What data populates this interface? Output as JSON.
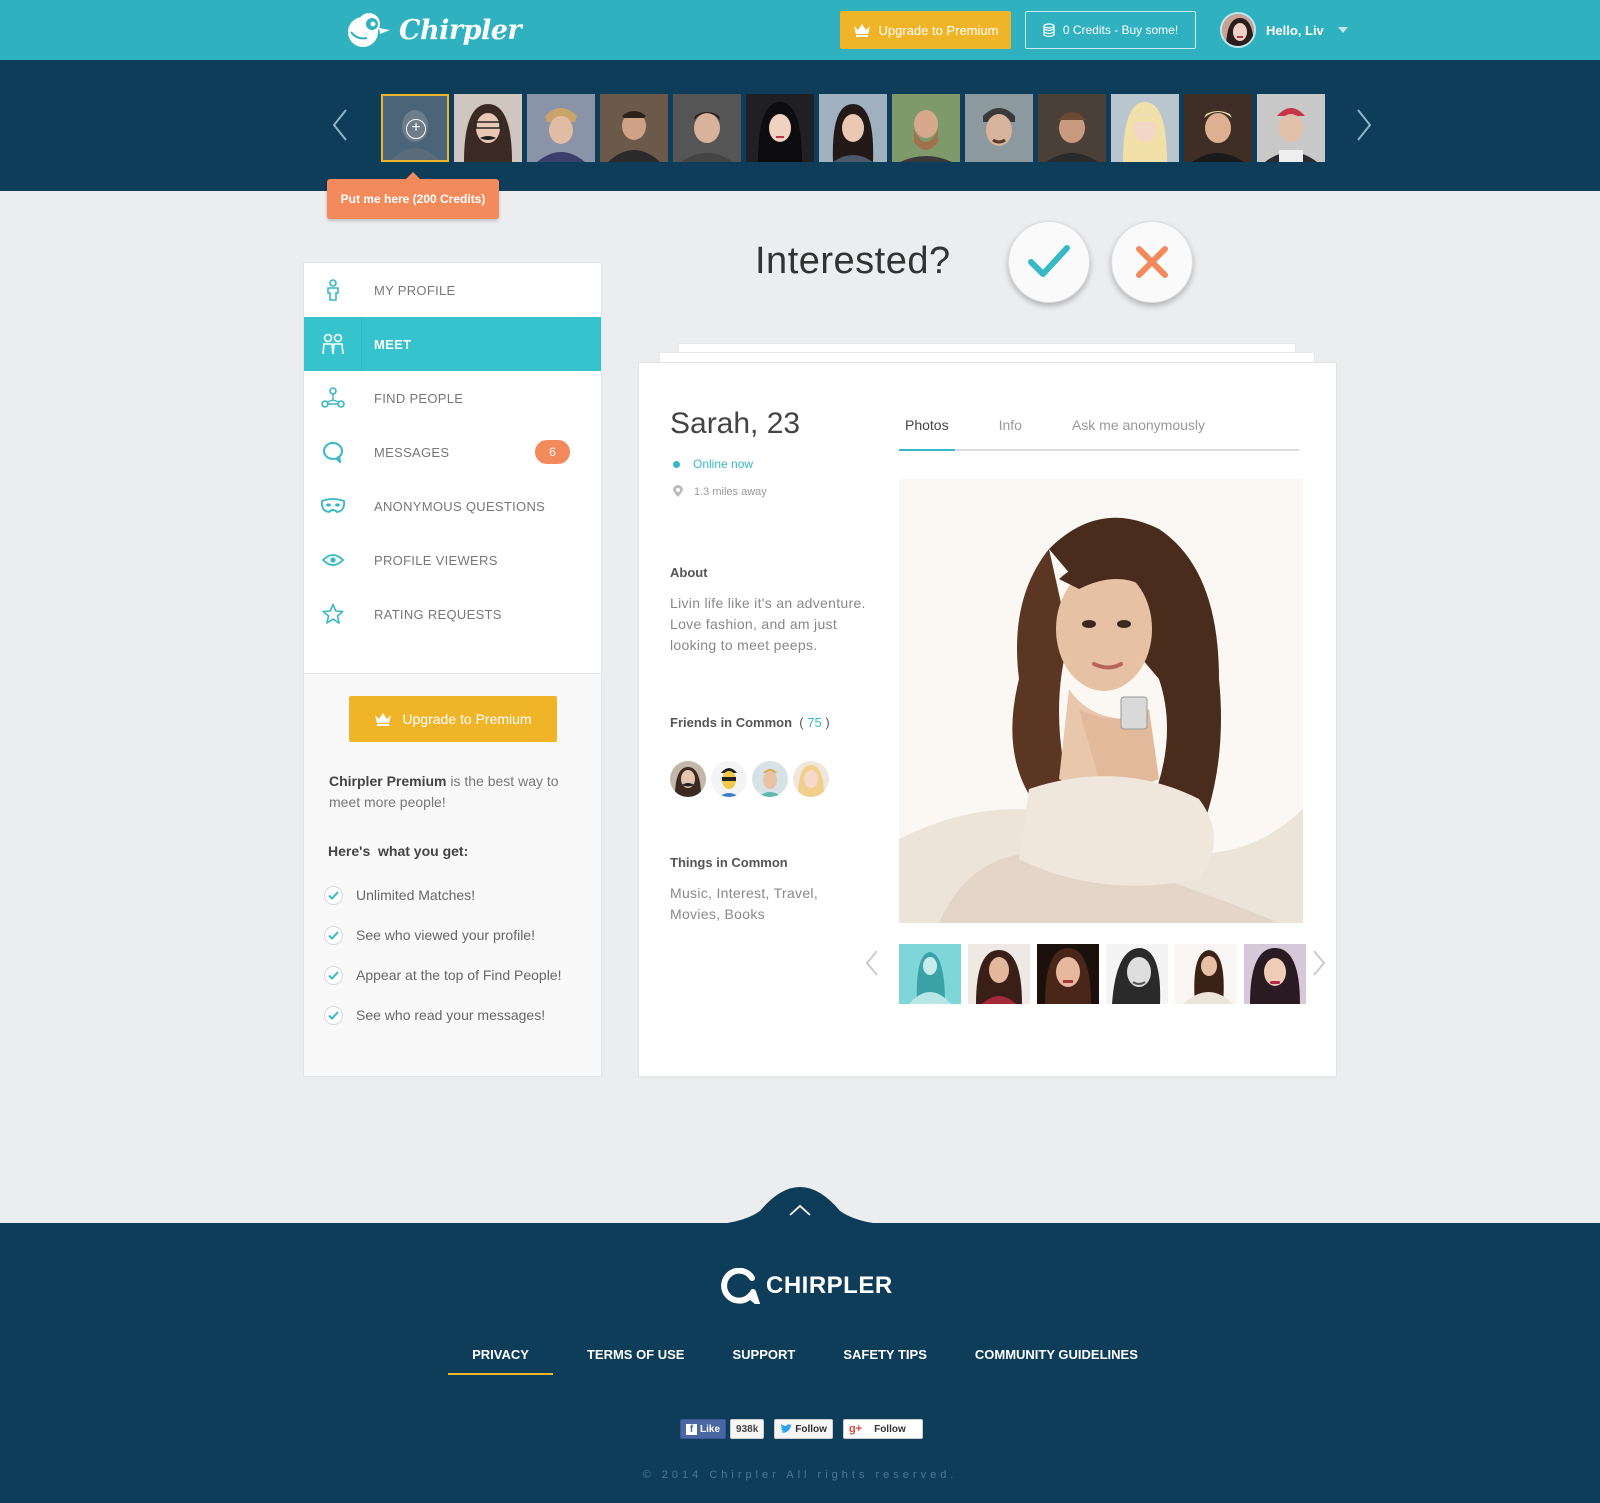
{
  "header": {
    "brand": "Chirpler",
    "upgrade_label": "Upgrade to Premium",
    "credits_label": "0 Credits - Buy some!",
    "greeting": "Hello, Liv"
  },
  "strip": {
    "tooltip": "Put me here (200 Credits)"
  },
  "sidebar": {
    "items": [
      {
        "label": "MY PROFILE",
        "icon": "person-icon"
      },
      {
        "label": "MEET",
        "icon": "people-icon"
      },
      {
        "label": "FIND PEOPLE",
        "icon": "network-icon"
      },
      {
        "label": "MESSAGES",
        "icon": "speech-bubble-icon",
        "badge": "6"
      },
      {
        "label": "ANONYMOUS QUESTIONS",
        "icon": "mask-icon"
      },
      {
        "label": "PROFILE VIEWERS",
        "icon": "eye-icon"
      },
      {
        "label": "RATING REQUESTS",
        "icon": "star-icon"
      }
    ],
    "premium": {
      "button": "Upgrade to Premium",
      "desc_bold": "Chirpler Premium",
      "desc_rest": " is the best way to meet more people!",
      "heading": "Here's  what you get:",
      "benefits": [
        "Unlimited Matches!",
        "See who viewed your profile!",
        "Appear at the top of Find People!",
        "See who read your messages!"
      ]
    }
  },
  "match": {
    "question": "Interested?"
  },
  "profile": {
    "name": "Sarah, 23",
    "status": "Online now",
    "distance": "1.3 miles away",
    "about_title": "About",
    "about_text": "Livin life like it's an adventure. Love fashion, and am just looking to meet peeps.",
    "friends_title": "Friends in Common",
    "friends_open": "(",
    "friends_count": "75",
    "friends_close": ")",
    "things_title": "Things in Common",
    "things_text": "Music, Interest, Travel, Movies, Books",
    "tabs": [
      "Photos",
      "Info",
      "Ask me anonymously"
    ]
  },
  "footer": {
    "brand": "CHIRPLER",
    "links": [
      "PRIVACY",
      "TERMS OF USE",
      "SUPPORT",
      "SAFETY TIPS",
      "COMMUNITY GUIDELINES"
    ],
    "fb_like": "Like",
    "fb_count": "938k",
    "twitter": "Follow",
    "gplus": "Follow",
    "copyright": "© 2014 Chirpler All rights reserved."
  },
  "colors": {
    "teal": "#2fb1c0",
    "navy": "#0d3d59",
    "gold": "#f0b429",
    "coral": "#f28a5b",
    "active": "#37c3cd"
  }
}
